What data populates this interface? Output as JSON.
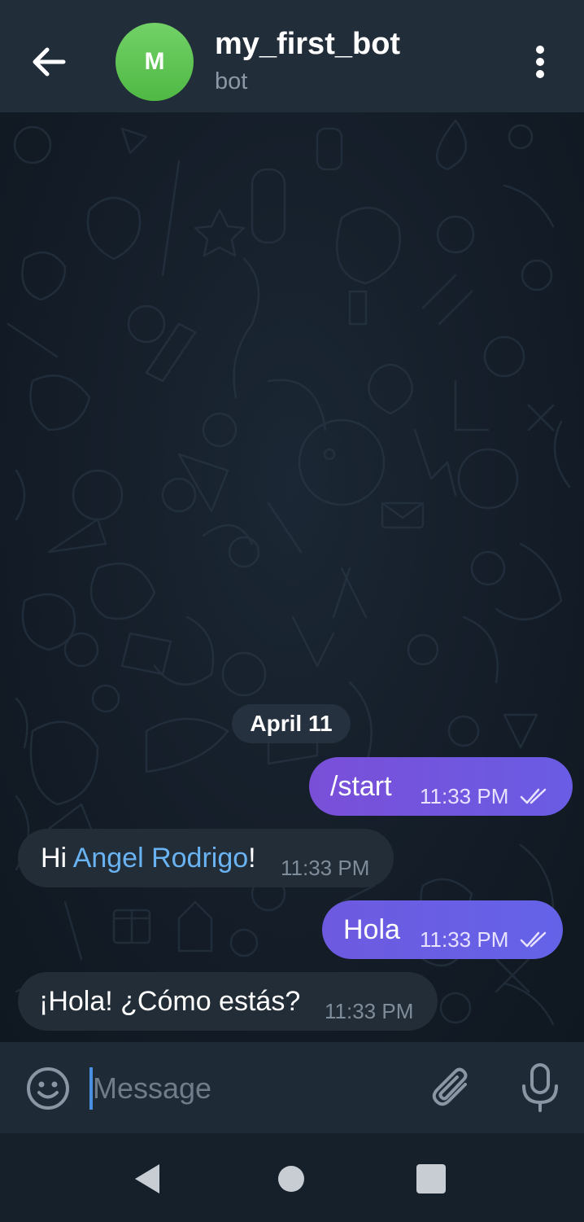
{
  "header": {
    "avatar_letter": "M",
    "avatar_color": "#5cc450",
    "title": "my_first_bot",
    "subtitle": "bot"
  },
  "chat": {
    "date_separator": "April 11",
    "messages": [
      {
        "direction": "outgoing",
        "text": "/start",
        "time": "11:33 PM",
        "status": "read"
      },
      {
        "direction": "incoming",
        "text_prefix": "Hi ",
        "mention": "Angel Rodrigo",
        "text_suffix": "!",
        "time": "11:33 PM"
      },
      {
        "direction": "outgoing",
        "text": "Hola",
        "time": "11:33 PM",
        "status": "read"
      },
      {
        "direction": "incoming",
        "text": "¡Hola! ¿Cómo estás?",
        "time": "11:33 PM"
      }
    ]
  },
  "input": {
    "placeholder": "Message",
    "value": ""
  },
  "icons": {
    "back": "arrow-left-icon",
    "more": "more-vertical-icon",
    "emoji": "emoji-icon",
    "attach": "paperclip-icon",
    "mic": "microphone-icon",
    "read_receipt": "double-check-icon"
  },
  "colors": {
    "header_bg": "#222d3a",
    "outgoing_bubble": "#7a4fd8",
    "incoming_bubble": "#222d38",
    "mention_link": "#6ab3f3",
    "input_bar_bg": "#1f2a37",
    "nav_bar_bg": "#16202b"
  }
}
